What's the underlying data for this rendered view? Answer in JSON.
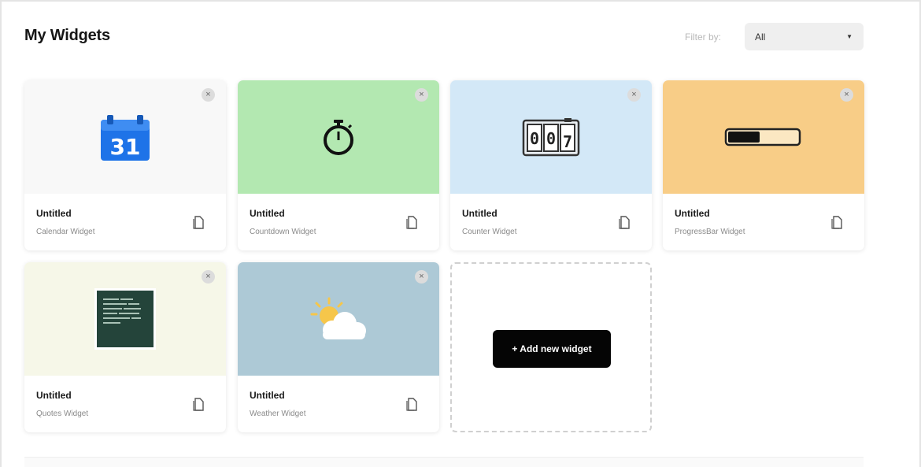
{
  "header": {
    "title": "My Widgets",
    "filter_label": "Filter by:",
    "filter_value": "All"
  },
  "widgets": [
    {
      "title": "Untitled",
      "type": "Calendar Widget",
      "thumb_bg": "#f8f8f8",
      "calendar_day": "31",
      "icon": "calendar-icon"
    },
    {
      "title": "Untitled",
      "type": "Countdown Widget",
      "thumb_bg": "#b3e8b1",
      "icon": "stopwatch-icon"
    },
    {
      "title": "Untitled",
      "type": "Counter Widget",
      "thumb_bg": "#d3e8f7",
      "counter_digits": [
        "0",
        "0",
        "7"
      ],
      "icon": "counter-icon"
    },
    {
      "title": "Untitled",
      "type": "ProgressBar Widget",
      "thumb_bg": "#f8cd87",
      "progress": 0.45,
      "icon": "progress-bar-icon"
    },
    {
      "title": "Untitled",
      "type": "Quotes Widget",
      "thumb_bg": "#f6f7e8",
      "icon": "quote-board-icon"
    },
    {
      "title": "Untitled",
      "type": "Weather Widget",
      "thumb_bg": "#adc9d6",
      "icon": "weather-icon"
    }
  ],
  "add_widget": {
    "label": "+ Add new widget"
  },
  "colors": {
    "accent": "#050505",
    "calendar_blue": "#1e73e8",
    "quote_board": "#24443a"
  }
}
